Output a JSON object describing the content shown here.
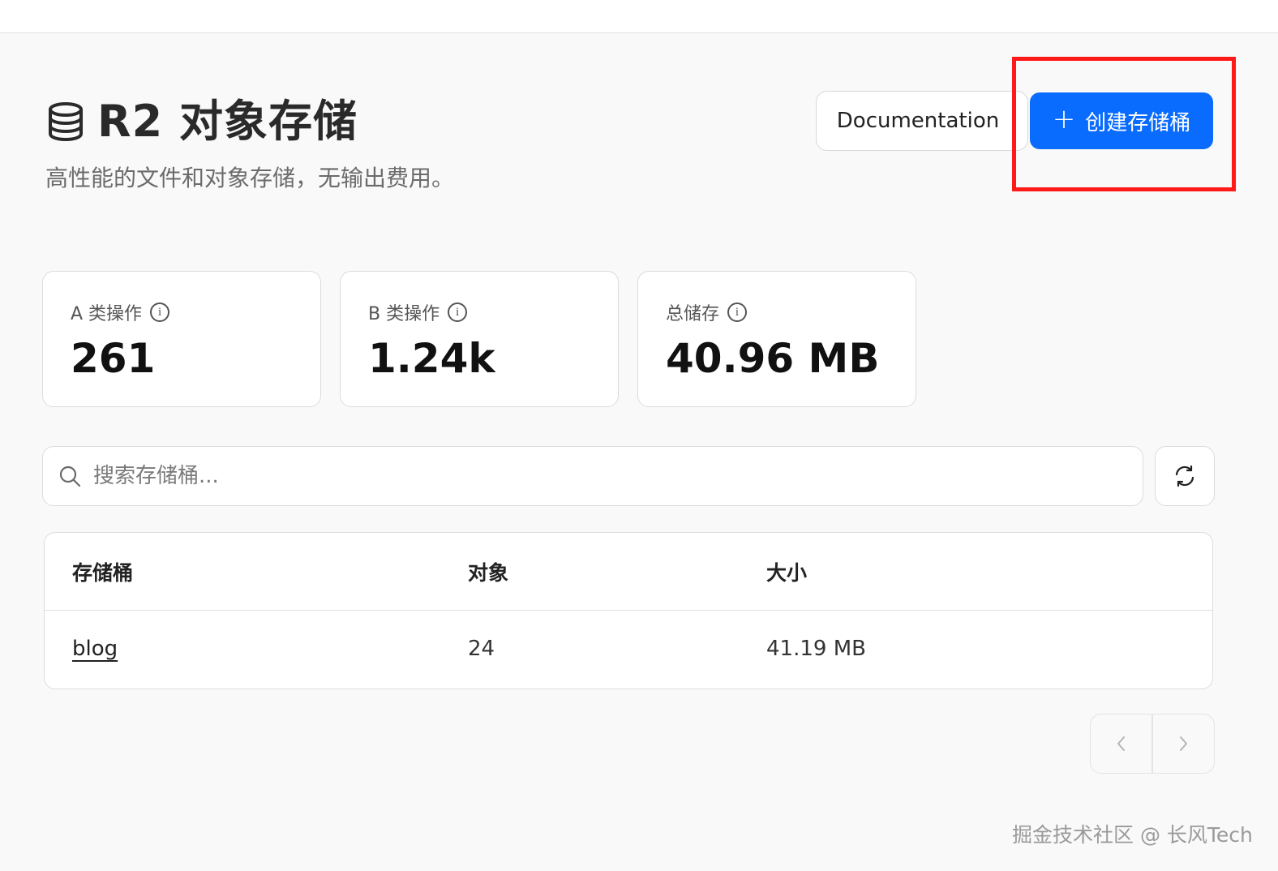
{
  "header": {
    "title": "R2 对象存储",
    "subtitle": "高性能的文件和对象存储，无输出费用。",
    "title_icon": "database-icon"
  },
  "actions": {
    "documentation_label": "Documentation",
    "create_label": "创建存储桶",
    "create_icon": "plus-icon",
    "accent_color": "#0a6cff",
    "highlight_color": "#ff1a1a"
  },
  "stats": [
    {
      "label": "A 类操作",
      "value": "261"
    },
    {
      "label": "B 类操作",
      "value": "1.24k"
    },
    {
      "label": "总储存",
      "value": "40.96 MB"
    }
  ],
  "search": {
    "placeholder": "搜索存储桶..."
  },
  "table": {
    "columns": [
      "存储桶",
      "对象",
      "大小"
    ],
    "rows": [
      {
        "bucket": "blog",
        "objects": "24",
        "size": "41.19 MB"
      }
    ]
  },
  "watermark": "掘金技术社区 @ 长风Tech"
}
